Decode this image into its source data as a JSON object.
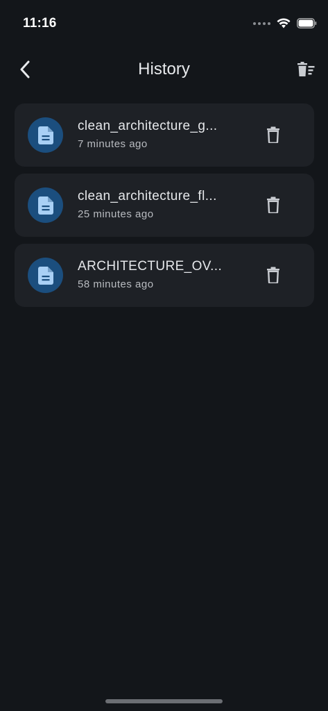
{
  "status_bar": {
    "time": "11:16",
    "icons": [
      "signal-dots-icon",
      "wifi-icon",
      "battery-icon"
    ]
  },
  "header": {
    "title": "History",
    "back_icon": "chevron-left-icon",
    "clear_icon": "clear-all-trash-icon"
  },
  "history": {
    "items": [
      {
        "name": "clean_architecture_g...",
        "time": "7 minutes ago"
      },
      {
        "name": "clean_architecture_fl...",
        "time": "25 minutes ago"
      },
      {
        "name": "ARCHITECTURE_OV...",
        "time": "58 minutes ago"
      }
    ]
  },
  "colors": {
    "background": "#13161a",
    "card": "#1e2126",
    "avatar": "#1b4e7e",
    "avatar_icon": "#a9d0f5"
  }
}
